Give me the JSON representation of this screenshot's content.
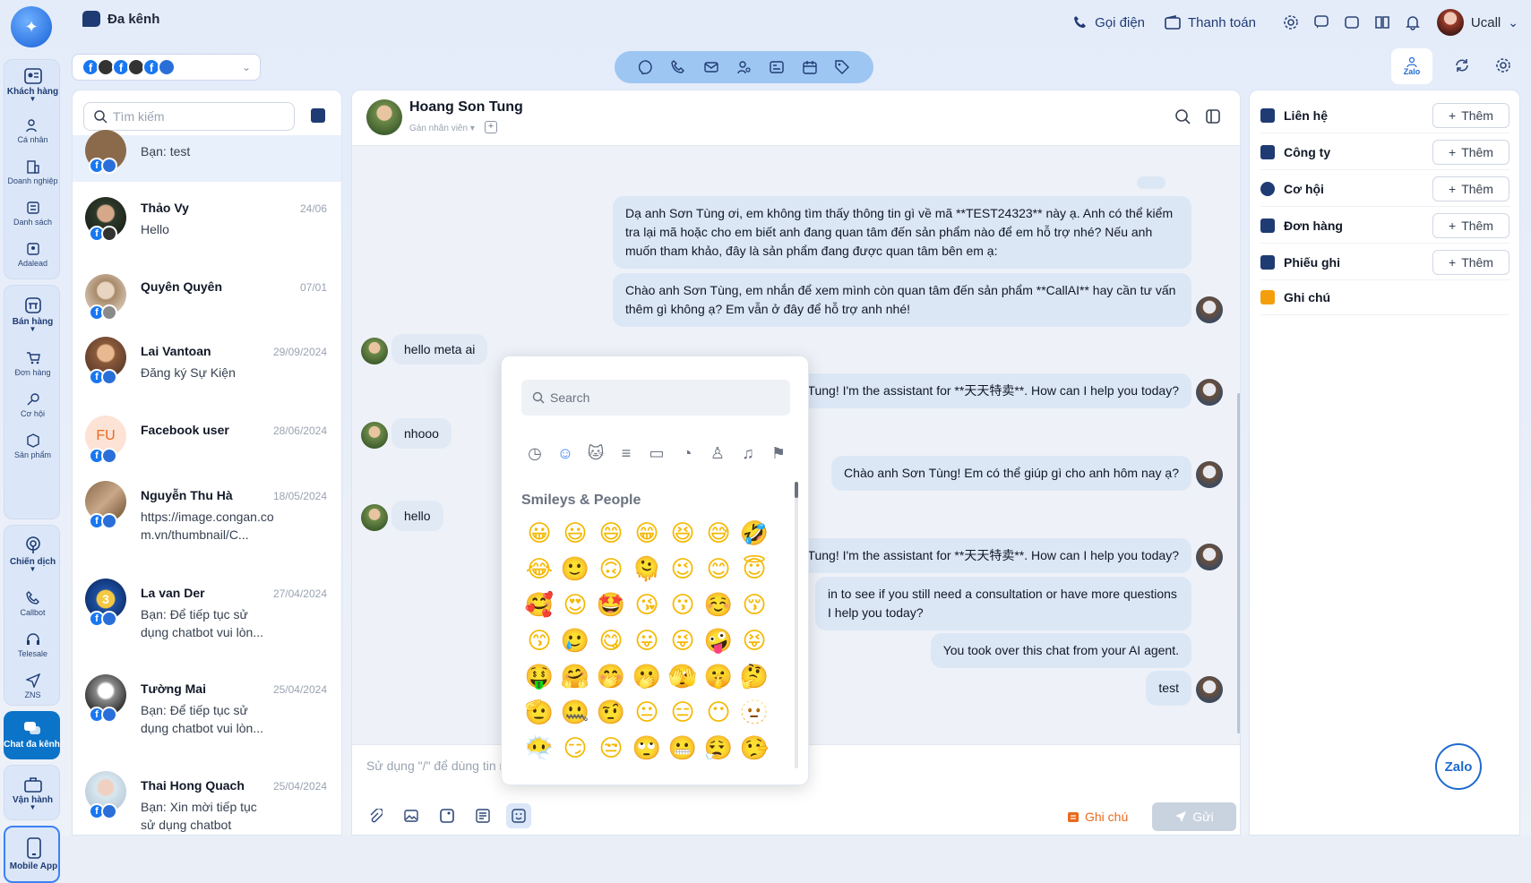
{
  "header": {
    "title": "Đa kênh",
    "call_label": "Gọi điện",
    "payment_label": "Thanh toán",
    "user_name": "Ucall"
  },
  "nav": {
    "sections": [
      {
        "label": "Khách hàng",
        "items": [
          "Cá nhân",
          "Doanh nghiệp",
          "Danh sách",
          "Adalead"
        ]
      },
      {
        "label": "Bán hàng",
        "items": [
          "Đơn hàng",
          "Cơ hội",
          "Sản phẩm"
        ]
      },
      {
        "label": "Chiến dịch",
        "items": [
          "Callbot",
          "Telesale",
          "ZNS"
        ]
      },
      {
        "label": "Chat đa kênh",
        "items": []
      },
      {
        "label": "Vận hành",
        "items": []
      },
      {
        "label": "Mobile App",
        "items": []
      }
    ]
  },
  "zalo_tab_label": "Zalo",
  "search_placeholder": "Tìm kiếm",
  "conversations": [
    {
      "name": "",
      "date": "",
      "msg": "Bạn: test"
    },
    {
      "name": "Thảo Vy",
      "date": "24/06",
      "msg": "Hello"
    },
    {
      "name": "Quyên Quyên",
      "date": "07/01",
      "msg": ""
    },
    {
      "name": "Lai Vantoan",
      "date": "29/09/2024",
      "msg": "Đăng ký Sự Kiện"
    },
    {
      "name": "Facebook user",
      "date": "28/06/2024",
      "msg": "",
      "initials": "FU"
    },
    {
      "name": "Nguyễn Thu Hà",
      "date": "18/05/2024",
      "msg": "https://image.congan.com.vn/thumbnail/C..."
    },
    {
      "name": "La van Der",
      "date": "27/04/2024",
      "msg": "Bạn: Để tiếp tục sử dụng chatbot vui lòn..."
    },
    {
      "name": "Tường Mai",
      "date": "25/04/2024",
      "msg": "Bạn: Để tiếp tục sử dụng chatbot vui lòn..."
    },
    {
      "name": "Thai Hong Quach",
      "date": "25/04/2024",
      "msg": "Bạn: Xin mời tiếp tục sử dụng chatbot"
    }
  ],
  "chat": {
    "name": "Hoang Son Tung",
    "assign": "Gán nhân viên",
    "messages_out": [
      "Dạ anh Sơn Tùng ơi, em không tìm thấy thông tin gì về mã **TEST24323** này ạ. Anh có thể kiểm tra lại mã hoặc cho em biết anh đang quan tâm đến sản phẩm nào để em hỗ trợ nhé? Nếu anh muốn tham khảo, đây là sản phẩm đang được quan tâm bên em ạ:",
      "Chào anh Sơn Tùng, em nhắn để xem mình còn quan tâm đến sản phẩm **CallAI** hay cần tư vấn thêm gì không ạ? Em vẫn ở đây để hỗ trợ anh nhé!",
      "Tung! I'm the assistant for **天天特卖**. How can I help you today?",
      "Chào anh Sơn Tùng! Em có thể giúp gì cho anh hôm nay ạ?",
      "Tung! I'm the assistant for **天天特卖**. How can I help you today?",
      "in to see if you still need a consultation or have more questions I help you today?",
      "You took over this chat from your AI agent.",
      "test"
    ],
    "messages_in": [
      "hello meta ai",
      "nhooo",
      "hello"
    ],
    "composer_placeholder": "Sử dụng \"/\" để dùng tin n",
    "note_label": "Ghi chú",
    "send_label": "Gửi"
  },
  "emoji_picker": {
    "search_placeholder": "Search",
    "section_title": "Smileys & People",
    "emojis": [
      "😀",
      "😃",
      "😄",
      "😁",
      "😆",
      "😅",
      "🤣",
      "😂",
      "🙂",
      "🙃",
      "🫠",
      "😉",
      "😊",
      "😇",
      "🥰",
      "😍",
      "🤩",
      "😘",
      "😗",
      "☺️",
      "😚",
      "😙",
      "🥲",
      "😋",
      "😛",
      "😜",
      "🤪",
      "😝",
      "🤑",
      "🤗",
      "🤭",
      "🫢",
      "🫣",
      "🤫",
      "🤔",
      "🫡",
      "🤐",
      "🤨",
      "😐",
      "😑",
      "😶",
      "🫥",
      "😶‍🌫️",
      "😏",
      "😒",
      "🙄",
      "😬",
      "😮‍💨",
      "🤥"
    ]
  },
  "right_panel": {
    "rows": [
      {
        "label": "Liên hệ",
        "add": "Thêm"
      },
      {
        "label": "Công ty",
        "add": "Thêm"
      },
      {
        "label": "Cơ hội",
        "add": "Thêm"
      },
      {
        "label": "Đơn hàng",
        "add": "Thêm"
      },
      {
        "label": "Phiếu ghi",
        "add": "Thêm"
      },
      {
        "label": "Ghi chú",
        "add": ""
      }
    ]
  },
  "zalo_float_label": "Zalo"
}
